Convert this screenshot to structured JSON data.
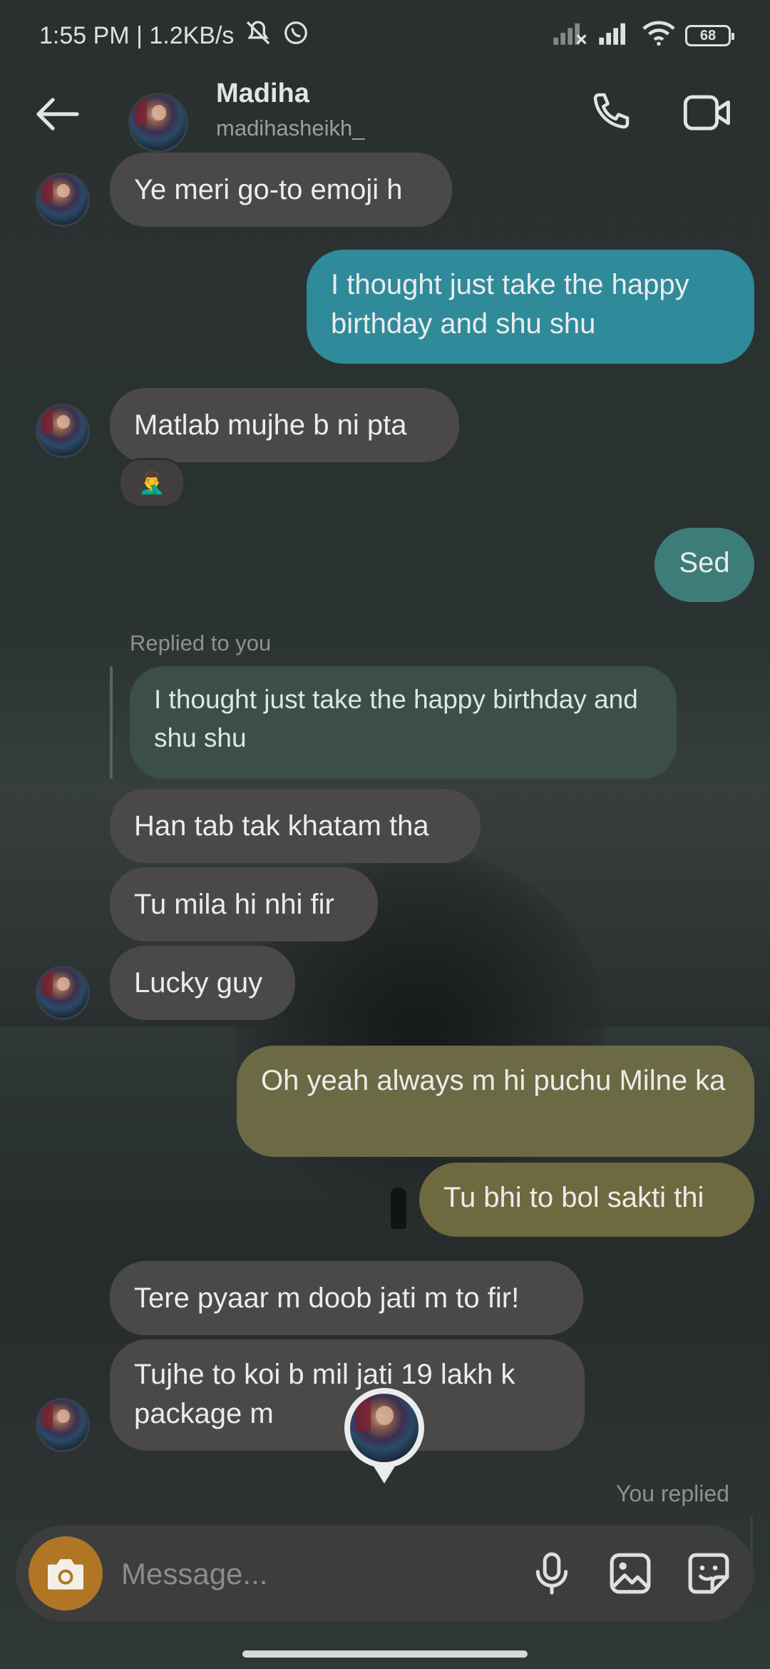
{
  "status_bar": {
    "time_speed": "1:55 PM | 1.2KB/s",
    "battery": "68"
  },
  "header": {
    "name": "Madiha",
    "username": "madihasheikh_"
  },
  "messages": {
    "m1": "Ye meri go-to emoji h",
    "m2": "I thought just take the happy birthday and shu shu",
    "m3": "Matlab mujhe b ni pta",
    "m3_reaction": "🤦‍♂️",
    "m4": "Sed",
    "reply_label": "Replied to you",
    "reply_quote": "I thought just take the happy birthday and shu shu",
    "m5": "Han tab tak khatam tha",
    "m6": "Tu mila hi nhi fir",
    "m7": "Lucky guy",
    "m8": "Oh yeah always m hi puchu Milne ka",
    "m9": "Tu bhi to bol sakti thi",
    "m10": "Tere pyaar m doob jati m to fir!",
    "m11": "Tujhe to koi b mil jati 19 lakh k package m",
    "you_replied": "You replied"
  },
  "composer": {
    "placeholder": "Message..."
  },
  "colors": {
    "outgoing_blue": "#2f8a9a",
    "outgoing_teal": "#3d7d79",
    "outgoing_olive": "#6b6a44",
    "incoming": "#4a4947",
    "camera_button": "#b07624"
  }
}
